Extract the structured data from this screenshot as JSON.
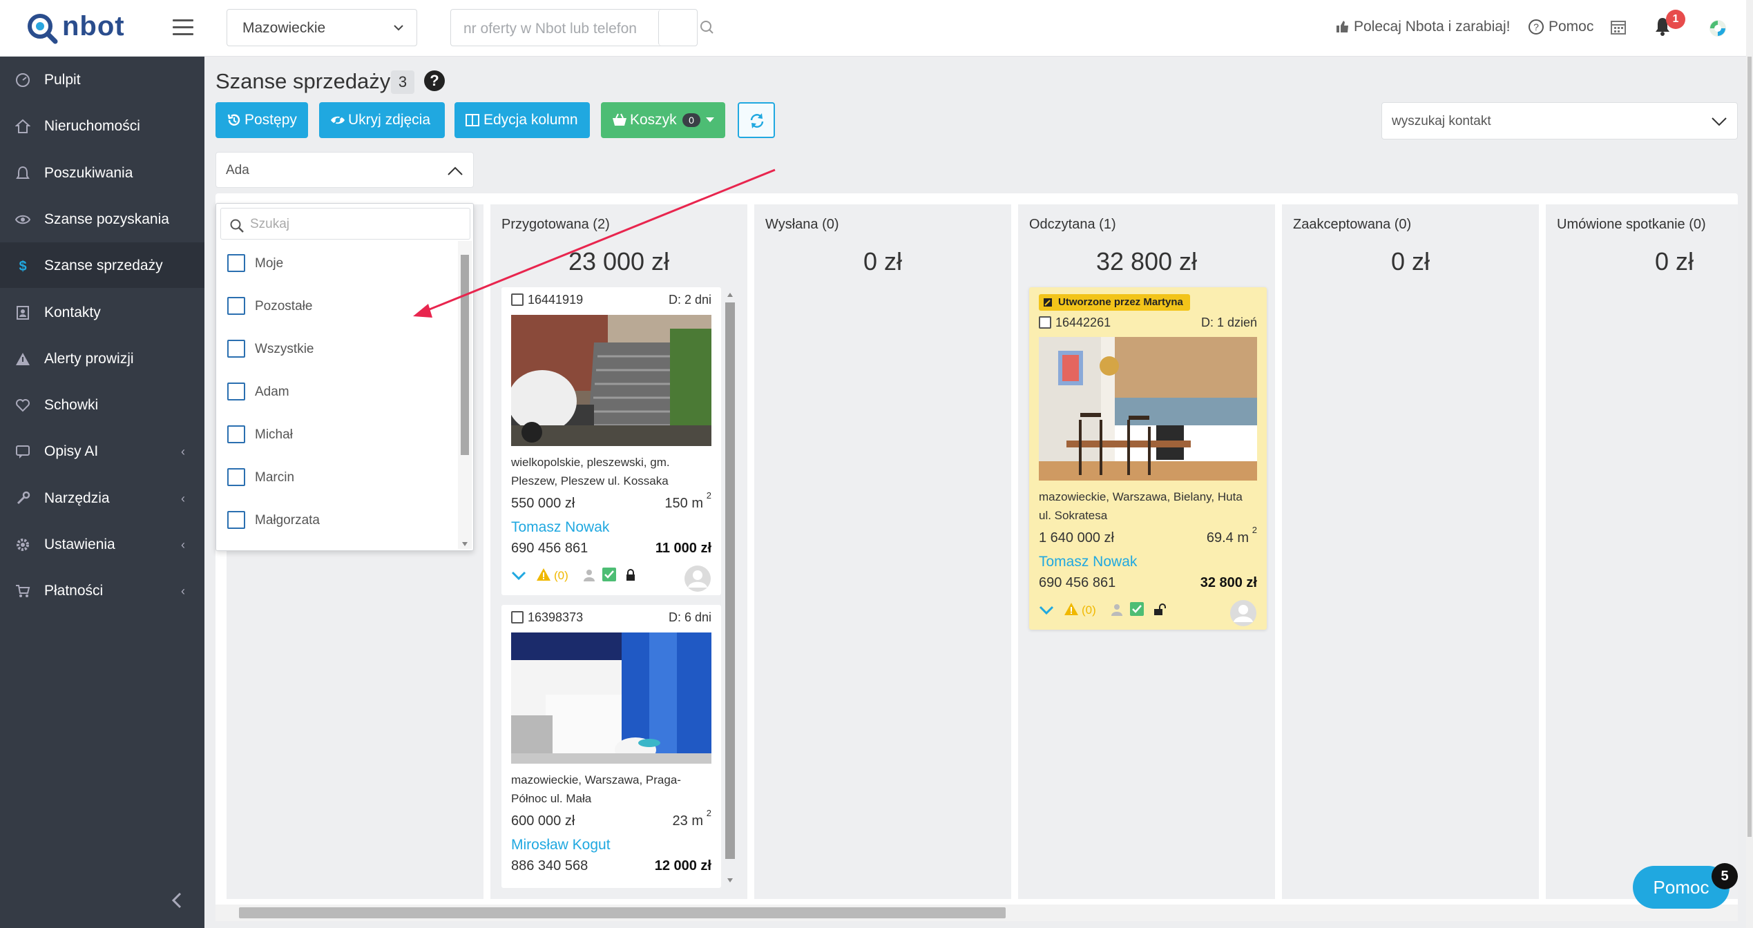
{
  "logo": {
    "text": "nbot"
  },
  "topbar": {
    "region": "Mazowieckie",
    "search_placeholder": "nr oferty w Nbot lub telefon",
    "refer_label": "Polecaj Nbota i zarabiaj!",
    "help_label": "Pomoc",
    "notifications_count": "1"
  },
  "sidebar": {
    "items": [
      {
        "label": "Pulpit",
        "icon": "dashboard-icon"
      },
      {
        "label": "Nieruchomości",
        "icon": "home-icon"
      },
      {
        "label": "Poszukiwania",
        "icon": "bell-icon"
      },
      {
        "label": "Szanse pozyskania",
        "icon": "eye-icon"
      },
      {
        "label": "Szanse sprzedaży",
        "icon": "dollar-icon"
      },
      {
        "label": "Kontakty",
        "icon": "contact-book-icon"
      },
      {
        "label": "Alerty prowizji",
        "icon": "warning-icon"
      },
      {
        "label": "Schowki",
        "icon": "heart-icon"
      },
      {
        "label": "Opisy AI",
        "icon": "comment-icon"
      },
      {
        "label": "Narzędzia",
        "icon": "wrench-icon"
      },
      {
        "label": "Ustawienia",
        "icon": "gear-icon"
      },
      {
        "label": "Płatności",
        "icon": "cart-icon"
      }
    ]
  },
  "page": {
    "title": "Szanse sprzedaży",
    "count": "3",
    "help": "?"
  },
  "toolbar": {
    "progress_label": "Postępy",
    "hide_photos_label": "Ukryj zdjęcia",
    "edit_columns_label": "Edycja kolumn",
    "cart_label": "Koszyk",
    "cart_count": "0",
    "contact_search_placeholder": "wyszukaj kontakt"
  },
  "owner_filter": {
    "value": "Ada",
    "search_placeholder": "Szukaj",
    "options": [
      "Moje",
      "Pozostałe",
      "Wszystkie",
      "Adam",
      "Michał",
      "Marcin",
      "Małgorzata"
    ]
  },
  "columns": [
    {
      "title": "Przygotowana (2)",
      "amount": "23 000 zł"
    },
    {
      "title": "Wysłana (0)",
      "amount": "0 zł"
    },
    {
      "title": "Odczytana (1)",
      "amount": "32 800 zł"
    },
    {
      "title": "Zaakceptowana (0)",
      "amount": "0 zł"
    },
    {
      "title": "Umówione spotkanie (0)",
      "amount": "0 zł"
    }
  ],
  "cards": [
    {
      "id": "16441919",
      "days": "D: 2 dni",
      "location": [
        "wielkopolskie, pleszewski, gm.",
        "Pleszew, Pleszew ul. Kossaka"
      ],
      "price": "550 000 zł",
      "area": "150 m",
      "area_sup": "2",
      "agent": "Tomasz Nowak",
      "phone": "690 456 861",
      "commission": "11 000 zł",
      "alerts": "(0)"
    },
    {
      "id": "16398373",
      "days": "D: 6 dni",
      "location": [
        "mazowieckie, Warszawa, Praga-",
        "Północ ul. Mała"
      ],
      "price": "600 000 zł",
      "area": "23 m",
      "area_sup": "2",
      "agent": "Mirosław Kogut",
      "phone": "886 340 568",
      "commission": "12 000 zł"
    },
    {
      "created_by": "Utworzone przez Martyna",
      "id": "16442261",
      "days": "D: 1 dzień",
      "location": [
        "mazowieckie, Warszawa, Bielany, Huta",
        "ul. Sokratesa"
      ],
      "price": "1 640 000 zł",
      "area": "69.4 m",
      "area_sup": "2",
      "agent": "Tomasz Nowak",
      "phone": "690 456 861",
      "commission": "32 800 zł",
      "alerts": "(0)"
    }
  ],
  "help_widget": {
    "label": "Pomoc",
    "count": "5"
  },
  "colors": {
    "accent": "#20a8e0",
    "green": "#4dbd74",
    "sidebar": "#353b45",
    "highlight_card": "#fbeeb0",
    "arrow": "#e8254e"
  }
}
